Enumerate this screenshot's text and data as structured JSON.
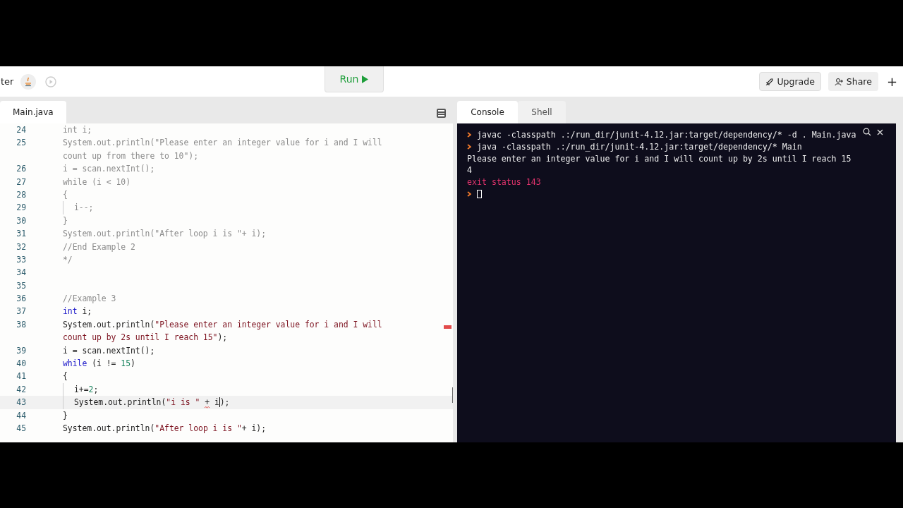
{
  "header": {
    "project_name": "ter",
    "run_button": "Run",
    "upgrade_button": "Upgrade",
    "share_button": "Share",
    "add_button": "+"
  },
  "editor": {
    "tabs": [
      {
        "label": "Main.java",
        "selected": true
      }
    ],
    "lines": [
      {
        "number": "24",
        "nested": false,
        "current": false,
        "rows": [
          [
            {
              "kind": "comment",
              "text": "int i;"
            }
          ]
        ]
      },
      {
        "number": "25",
        "nested": false,
        "current": false,
        "rows": [
          [
            {
              "kind": "comment",
              "text": "System.out.println(\"Please enter an integer value for i and I will"
            }
          ],
          [
            {
              "kind": "comment",
              "text": "count up from there to 10\");"
            }
          ]
        ]
      },
      {
        "number": "26",
        "nested": false,
        "current": false,
        "rows": [
          [
            {
              "kind": "comment",
              "text": "i = scan.nextInt();"
            }
          ]
        ]
      },
      {
        "number": "27",
        "nested": false,
        "current": false,
        "rows": [
          [
            {
              "kind": "comment",
              "text": "while (i < 10)"
            }
          ]
        ]
      },
      {
        "number": "28",
        "nested": false,
        "current": false,
        "rows": [
          [
            {
              "kind": "comment",
              "text": "{"
            }
          ]
        ]
      },
      {
        "number": "29",
        "nested": true,
        "current": false,
        "rows": [
          [
            {
              "kind": "comment",
              "text": "i--;"
            }
          ]
        ]
      },
      {
        "number": "30",
        "nested": false,
        "current": false,
        "rows": [
          [
            {
              "kind": "comment",
              "text": "}"
            }
          ]
        ]
      },
      {
        "number": "31",
        "nested": false,
        "current": false,
        "rows": [
          [
            {
              "kind": "comment",
              "text": "System.out.println(\"After loop i is \"+ i);"
            }
          ]
        ]
      },
      {
        "number": "32",
        "nested": false,
        "current": false,
        "rows": [
          [
            {
              "kind": "comment",
              "text": "//End Example 2"
            }
          ]
        ]
      },
      {
        "number": "33",
        "nested": false,
        "current": false,
        "rows": [
          [
            {
              "kind": "comment",
              "text": "*/"
            }
          ]
        ]
      },
      {
        "number": "34",
        "nested": false,
        "current": false,
        "rows": [
          []
        ]
      },
      {
        "number": "35",
        "nested": false,
        "current": false,
        "rows": [
          []
        ]
      },
      {
        "number": "36",
        "nested": false,
        "current": false,
        "rows": [
          [
            {
              "kind": "comment",
              "text": "//Example 3"
            }
          ]
        ]
      },
      {
        "number": "37",
        "nested": false,
        "current": false,
        "rows": [
          [
            {
              "kind": "keyword",
              "text": "int"
            },
            {
              "kind": "plain",
              "text": " i;"
            }
          ]
        ]
      },
      {
        "number": "38",
        "nested": false,
        "current": false,
        "rows": [
          [
            {
              "kind": "plain",
              "text": "System.out.println("
            },
            {
              "kind": "string",
              "text": "\"Please enter an integer value for i and I will"
            }
          ],
          [
            {
              "kind": "string",
              "text": "count up by 2s until I reach 15\""
            },
            {
              "kind": "plain",
              "text": ");"
            }
          ]
        ]
      },
      {
        "number": "39",
        "nested": false,
        "current": false,
        "rows": [
          [
            {
              "kind": "plain",
              "text": "i = scan.nextInt();"
            }
          ]
        ]
      },
      {
        "number": "40",
        "nested": false,
        "current": false,
        "rows": [
          [
            {
              "kind": "keyword",
              "text": "while"
            },
            {
              "kind": "plain",
              "text": " (i != "
            },
            {
              "kind": "number",
              "text": "15"
            },
            {
              "kind": "plain",
              "text": ")"
            }
          ]
        ]
      },
      {
        "number": "41",
        "nested": false,
        "current": false,
        "rows": [
          [
            {
              "kind": "plain",
              "text": "{"
            }
          ]
        ]
      },
      {
        "number": "42",
        "nested": true,
        "current": false,
        "rows": [
          [
            {
              "kind": "plain",
              "text": "i+="
            },
            {
              "kind": "number",
              "text": "2"
            },
            {
              "kind": "plain",
              "text": ";"
            }
          ]
        ]
      },
      {
        "number": "43",
        "nested": true,
        "current": true,
        "rows": [
          [
            {
              "kind": "plain",
              "text": "System.out.println("
            },
            {
              "kind": "string",
              "text": "\"i is \""
            },
            {
              "kind": "space",
              "text": " "
            },
            {
              "kind": "error",
              "text": "+"
            },
            {
              "kind": "plain",
              "text": " i"
            },
            {
              "kind": "cursor"
            },
            {
              "kind": "plain",
              "text": ");"
            }
          ]
        ]
      },
      {
        "number": "44",
        "nested": false,
        "current": false,
        "rows": [
          [
            {
              "kind": "plain",
              "text": "}"
            }
          ]
        ]
      },
      {
        "number": "45",
        "nested": false,
        "current": false,
        "rows": [
          [
            {
              "kind": "plain",
              "text": "System.out.println("
            },
            {
              "kind": "string",
              "text": "\"After loop i is \""
            },
            {
              "kind": "plain",
              "text": "+ i);"
            }
          ]
        ]
      }
    ]
  },
  "console": {
    "tabs": [
      {
        "label": "Console",
        "selected": true
      },
      {
        "label": "Shell",
        "selected": false
      }
    ],
    "lines": [
      {
        "kind": "command",
        "text": "javac -classpath .:/run_dir/junit-4.12.jar:target/dependency/* -d . Main.java"
      },
      {
        "kind": "command",
        "text": "java -classpath .:/run_dir/junit-4.12.jar:target/dependency/* Main"
      },
      {
        "kind": "output",
        "text": "Please enter an integer value for i and I will count up by 2s until I reach 15"
      },
      {
        "kind": "output",
        "text": "4"
      },
      {
        "kind": "error",
        "text": "exit status 143"
      },
      {
        "kind": "prompt"
      }
    ]
  }
}
